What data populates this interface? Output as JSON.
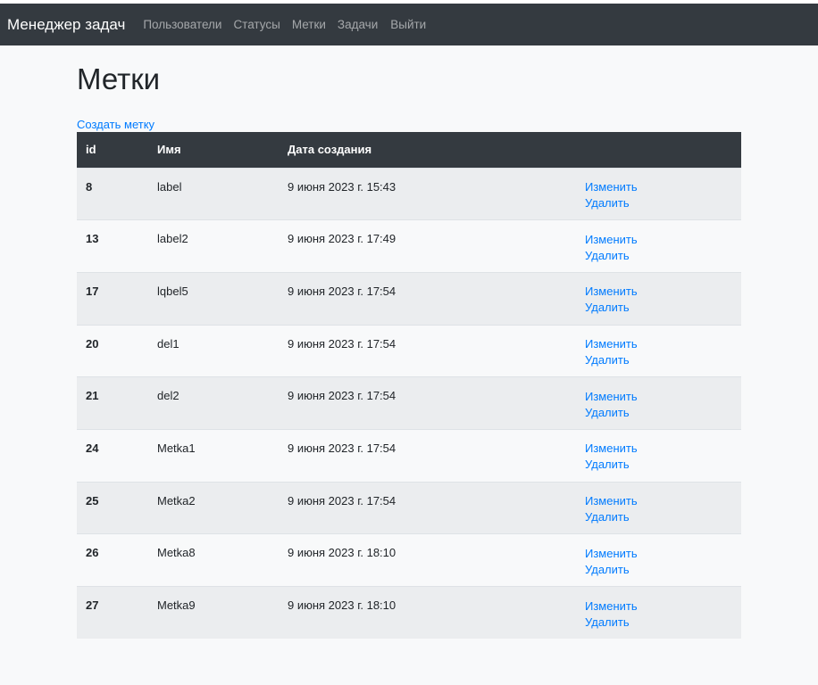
{
  "navbar": {
    "brand": "Менеджер задач",
    "links": [
      "Пользователи",
      "Статусы",
      "Метки",
      "Задачи"
    ],
    "logout": "Выйти"
  },
  "page": {
    "title": "Метки",
    "create_link": "Создать метку"
  },
  "table": {
    "headers": [
      "id",
      "Имя",
      "Дата создания",
      ""
    ],
    "edit_label": "Изменить",
    "delete_label": "Удалить",
    "rows": [
      {
        "id": "8",
        "name": "label",
        "created": "9 июня 2023 г. 15:43"
      },
      {
        "id": "13",
        "name": "label2",
        "created": "9 июня 2023 г. 17:49"
      },
      {
        "id": "17",
        "name": "lqbel5",
        "created": "9 июня 2023 г. 17:54"
      },
      {
        "id": "20",
        "name": "del1",
        "created": "9 июня 2023 г. 17:54"
      },
      {
        "id": "21",
        "name": "del2",
        "created": "9 июня 2023 г. 17:54"
      },
      {
        "id": "24",
        "name": "Metka1",
        "created": "9 июня 2023 г. 17:54"
      },
      {
        "id": "25",
        "name": "Metka2",
        "created": "9 июня 2023 г. 17:54"
      },
      {
        "id": "26",
        "name": "Metka8",
        "created": "9 июня 2023 г. 18:10"
      },
      {
        "id": "27",
        "name": "Metka9",
        "created": "9 июня 2023 г. 18:10"
      }
    ]
  },
  "colors": {
    "navbar_bg": "#343a40",
    "link": "#007bff",
    "page_bg": "#f8f9fa",
    "striped_row": "#ebedef"
  }
}
